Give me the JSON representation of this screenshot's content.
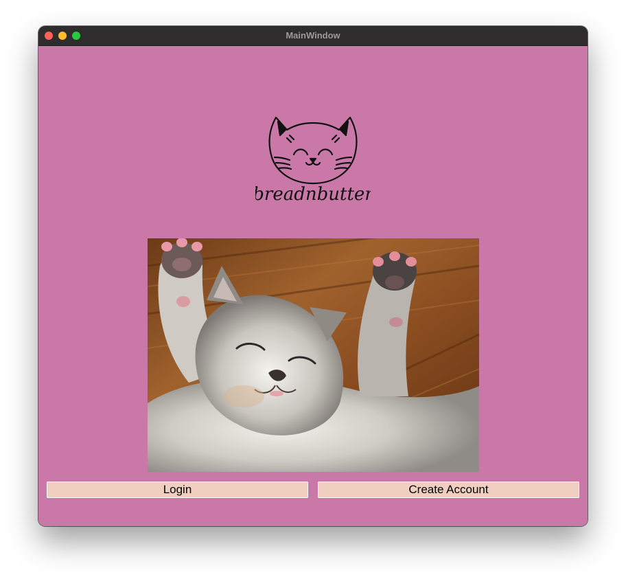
{
  "window": {
    "title": "MainWindow"
  },
  "logo": {
    "wordmark": "breadnbutter",
    "icon": "cat-face-icon"
  },
  "photo": {
    "subject": "kitten-photo"
  },
  "buttons": {
    "login_label": "Login",
    "create_account_label": "Create Account"
  },
  "colors": {
    "background": "#c978a7",
    "button": "#f0cfc0",
    "titlebar": "#2e2c2d"
  }
}
